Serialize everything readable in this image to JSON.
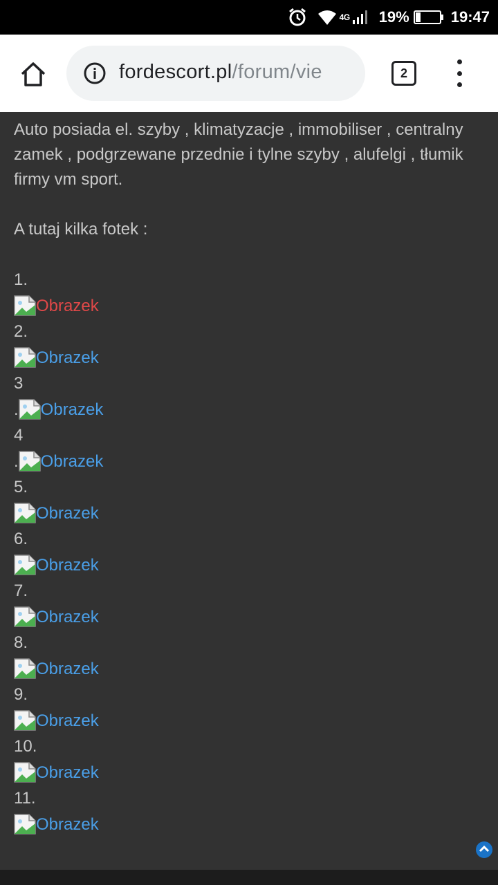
{
  "status_bar": {
    "network": "4G",
    "battery": "19%",
    "time": "19:47"
  },
  "browser": {
    "url_domain": "fordescort.pl",
    "url_path": "/forum/vie",
    "tab_count": "2"
  },
  "content": {
    "paragraph1": "Auto posiada el. szyby , klimatyzacje , immobiliser , centralny zamek , podgrzewane przednie i tylne szyby , alufelgi , tłumik firmy vm sport.",
    "paragraph2": "A tutaj kilka fotek :",
    "items": [
      {
        "num": "1.",
        "prefix": "",
        "link": "Obrazek"
      },
      {
        "num": "2.",
        "prefix": "",
        "link": "Obrazek"
      },
      {
        "num": "3",
        "prefix": ".",
        "link": "Obrazek"
      },
      {
        "num": "4",
        "prefix": ".",
        "link": "Obrazek"
      },
      {
        "num": "5.",
        "prefix": "",
        "link": "Obrazek"
      },
      {
        "num": "6.",
        "prefix": "",
        "link": "Obrazek"
      },
      {
        "num": "7.",
        "prefix": "",
        "link": "Obrazek"
      },
      {
        "num": "8.",
        "prefix": "",
        "link": "Obrazek"
      },
      {
        "num": "9.",
        "prefix": "",
        "link": "Obrazek"
      },
      {
        "num": "10.",
        "prefix": "",
        "link": "Obrazek"
      },
      {
        "num": "11.",
        "prefix": "",
        "link": "Obrazek"
      }
    ]
  },
  "colors": {
    "background": "#323232",
    "text": "#c8c8c8",
    "link": "#4a9fe8",
    "link_active": "#e04848"
  }
}
